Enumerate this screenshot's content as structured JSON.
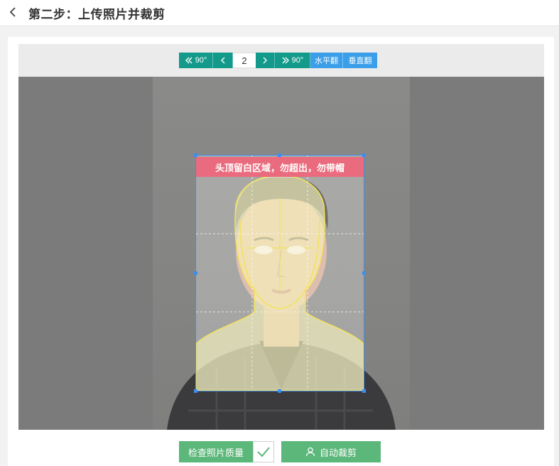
{
  "header": {
    "title": "第二步：上传照片并裁剪"
  },
  "toolbar": {
    "rotate_left_label": "90°",
    "current_page": "2",
    "rotate_right_label": "90°",
    "flip_horizontal_label": "水平翻",
    "flip_vertical_label": "垂直翻",
    "colors": {
      "teal": "#139a8a",
      "blue": "#3a9ee8"
    }
  },
  "crop": {
    "banner_text": "头顶留白区域，勿超出，勿带帽",
    "banner_color": "#ea6b7d",
    "frame_color": "#3d8ef0"
  },
  "actions": {
    "check_quality_label": "检查照片质量",
    "auto_crop_label": "自动裁剪",
    "button_color": "#5cb77a"
  }
}
